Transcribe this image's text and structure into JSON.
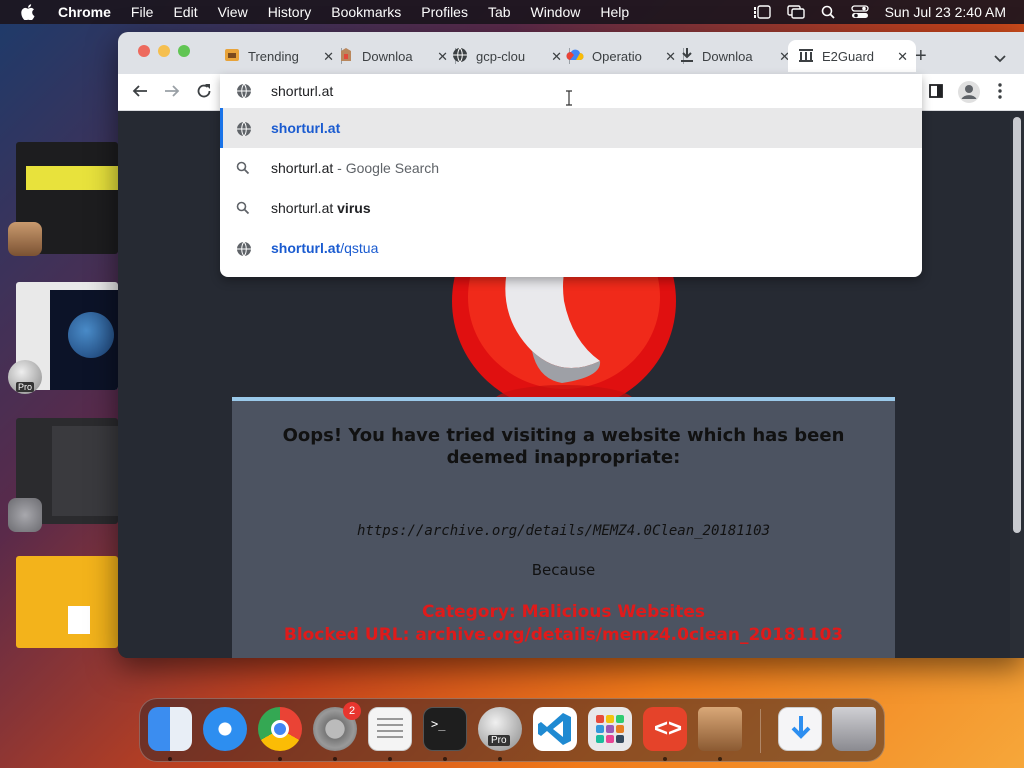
{
  "menubar": {
    "app": "Chrome",
    "items": [
      "File",
      "Edit",
      "View",
      "History",
      "Bookmarks",
      "Profiles",
      "Tab",
      "Window",
      "Help"
    ],
    "clock": "Sun Jul 23  2:40 AM"
  },
  "tabs": [
    {
      "title": "Trending",
      "icon": "trending-icon"
    },
    {
      "title": "Downloa",
      "icon": "app-icon"
    },
    {
      "title": "gcp-clou",
      "icon": "globe-icon"
    },
    {
      "title": "Operatio",
      "icon": "cloud-icon"
    },
    {
      "title": "Downloa",
      "icon": "download-icon"
    },
    {
      "title": "E2Guard",
      "icon": "building-icon",
      "active": true
    }
  ],
  "omnibox": {
    "input": "shorturl.at",
    "suggestions": [
      {
        "icon": "globe-icon",
        "prefix": "shorturl.at",
        "suffix": ""
      },
      {
        "icon": "search-icon",
        "prefix": "shorturl.at",
        "suffix": " - Google Search"
      },
      {
        "icon": "search-icon",
        "prefix": "shorturl.at ",
        "suffix": "virus"
      },
      {
        "icon": "globe-icon",
        "prefix": "shorturl.at",
        "suffix": "/qstua"
      }
    ]
  },
  "block_page": {
    "headline": "Oops! You have tried visiting a website which has been deemed inappropriate:",
    "url": "https://archive.org/details/MEMZ4.0Clean_20181103",
    "because": "Because",
    "category": "Category: Malicious Websites",
    "blocked_url": "Blocked URL: archive.org/details/memz4.0clean_20181103"
  },
  "dock": {
    "settings_badge": "2",
    "pro_label": "Pro"
  },
  "stage": {
    "pro_label": "Pro"
  }
}
